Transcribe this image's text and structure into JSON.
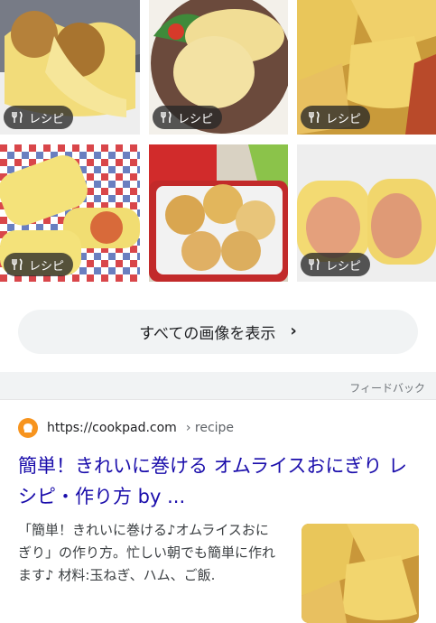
{
  "image_results": {
    "badge_label": "レシピ",
    "badge_icon": "fork-knife-icon"
  },
  "show_all": {
    "label": "すべての画像を表示",
    "chevron": "›"
  },
  "feedback": "フィードバック",
  "result": {
    "site_url": "https://cookpad.com",
    "site_path": "› recipe",
    "title": "簡単！きれいに巻ける オムライスおにぎり レシピ・作り方 by ...",
    "snippet": "「簡単！きれいに巻ける♪オムライスおにぎり」の作り方。忙しい朝でも簡単に作れます♪ 材料:玉ねぎ、ハム、ご飯."
  },
  "colors": {
    "link": "#1a0dab",
    "site_icon": "#f7941e",
    "omelette": "#f2d46a"
  }
}
